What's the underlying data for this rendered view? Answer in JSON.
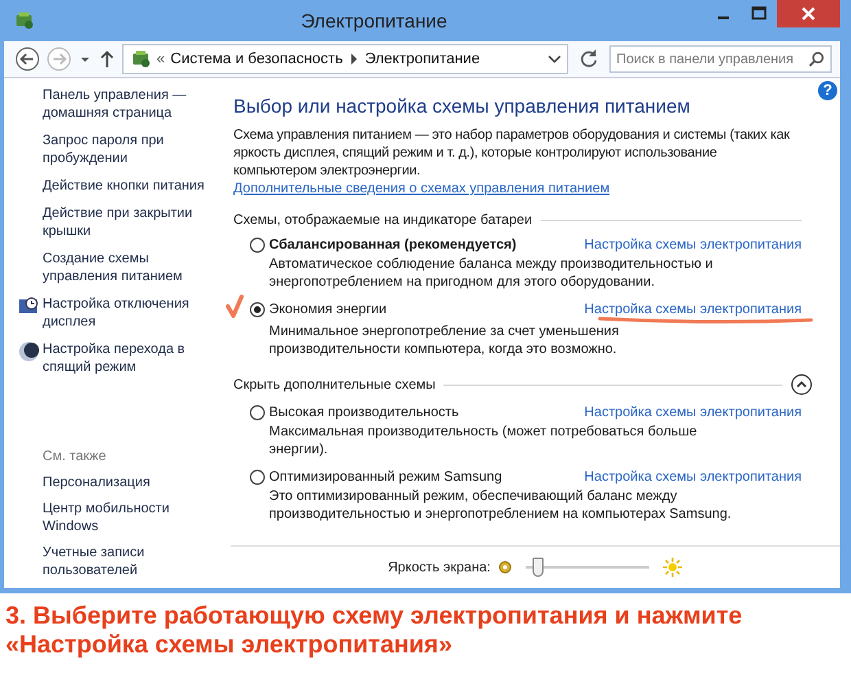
{
  "window": {
    "title": "Электропитание"
  },
  "address_bar": {
    "prefix": "«",
    "path": [
      {
        "label": "Система и безопасность"
      },
      {
        "label": "Электропитание"
      }
    ]
  },
  "search": {
    "placeholder": "Поиск в панели управления"
  },
  "sidebar": {
    "items": [
      {
        "label": "Панель управления — домашняя страница",
        "kind": "link"
      },
      {
        "label": "Запрос пароля при пробуждении",
        "kind": "link"
      },
      {
        "label": "Действие кнопки питания",
        "kind": "link"
      },
      {
        "label": "Действие при закрытии крышки",
        "kind": "link"
      },
      {
        "label": "Создание схемы управления питанием",
        "kind": "link"
      },
      {
        "label": "Настройка отключения дисплея",
        "kind": "display-link"
      },
      {
        "label": "Настройка перехода в спящий режим",
        "kind": "sleep-link"
      }
    ],
    "see_also": {
      "heading": "См. также",
      "items": [
        {
          "label": "Персонализация"
        },
        {
          "label": "Центр мобильности Windows"
        },
        {
          "label": "Учетные записи пользователей"
        }
      ]
    }
  },
  "main": {
    "help_button": "?",
    "heading": "Выбор или настройка схемы управления питанием",
    "description": "Схема управления питанием — это набор параметров оборудования и системы (таких как яркость дисплея, спящий режим и т. д.), которые контролируют использование компьютером электроэнергии.",
    "more_link": "Дополнительные сведения о схемах управления питанием",
    "groups": [
      {
        "title": "Схемы, отображаемые на индикаторе батареи",
        "collapse_button": false,
        "plans": [
          {
            "name": "Сбалансированная (рекомендуется)",
            "bold": true,
            "selected": false,
            "annotated": false,
            "link": "Настройка схемы электропитания",
            "description": "Автоматическое соблюдение баланса между производительностью и энергопотреблением на пригодном для этого оборудовании."
          },
          {
            "name": "Экономия энергии",
            "bold": false,
            "selected": true,
            "annotated": true,
            "link": "Настройка схемы электропитания",
            "description": "Минимальное энергопотребление за счет уменьшения производительности компьютера, когда это возможно."
          }
        ]
      },
      {
        "title": "Скрыть дополнительные схемы",
        "collapse_button": true,
        "plans": [
          {
            "name": "Высокая производительность",
            "bold": false,
            "selected": false,
            "annotated": false,
            "link": "Настройка схемы электропитания",
            "description": "Максимальная производительность (может потребоваться больше энергии)."
          },
          {
            "name": "Оптимизированный режим Samsung",
            "bold": false,
            "selected": false,
            "annotated": false,
            "link": "Настройка схемы электропитания",
            "description": "Это оптимизированный режим, обеспечивающий баланс между производительностью и энергопотреблением на компьютерах Samsung."
          }
        ]
      }
    ],
    "brightness": {
      "label": "Яркость экрана:",
      "level": 0.1
    }
  },
  "caption": "3. Выберите работающую схему электропитания и нажмите «Настройка схемы электропитания»"
}
